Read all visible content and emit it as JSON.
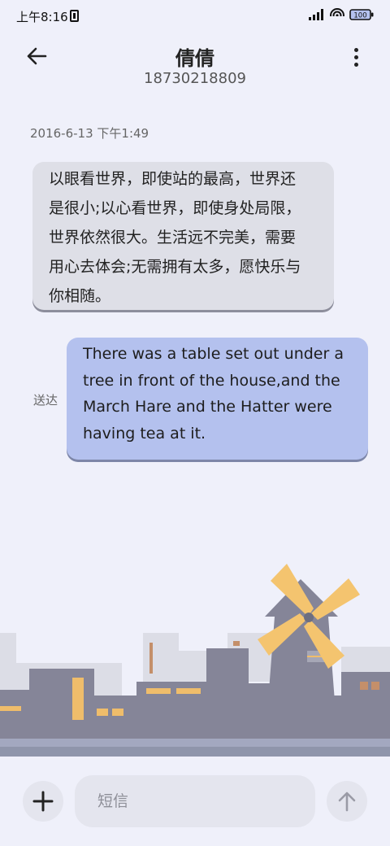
{
  "status_bar": {
    "time": "上午8:16",
    "battery": "100"
  },
  "header": {
    "contact_name": "倩倩",
    "phone_number": "18730218809"
  },
  "conversation": {
    "date": "2016-6-13 下午1:49",
    "messages": [
      {
        "direction": "incoming",
        "lines": [
          "以眼看世界，即使站的最高，世界还",
          "是很小;以心看世界，即使身处局限，",
          "世界依然很大。生活远不完美，需要",
          "用心去体会;无需拥有太多，愿快乐与",
          "你相随。"
        ]
      },
      {
        "direction": "outgoing",
        "status": "送达",
        "lines": [
          "There was a table set out under a",
          "tree in front of the house,and the",
          "March Hare and the Hatter were",
          "having tea at it."
        ]
      }
    ]
  },
  "composer": {
    "placeholder": "短信"
  },
  "colors": {
    "background": "#eff0fa",
    "incoming_bubble": "#dedfe7",
    "outgoing_bubble": "#b4c1ee",
    "building": "#858598",
    "window": "#efbd6b",
    "windmill_blade": "#f4c46f"
  },
  "icons": {
    "back": "arrow-left-icon",
    "more": "more-vertical-icon",
    "add": "plus-icon",
    "send": "arrow-up-icon",
    "signal": "signal-icon",
    "wifi": "wifi-icon",
    "battery": "battery-icon",
    "sim": "sim-card-icon"
  }
}
